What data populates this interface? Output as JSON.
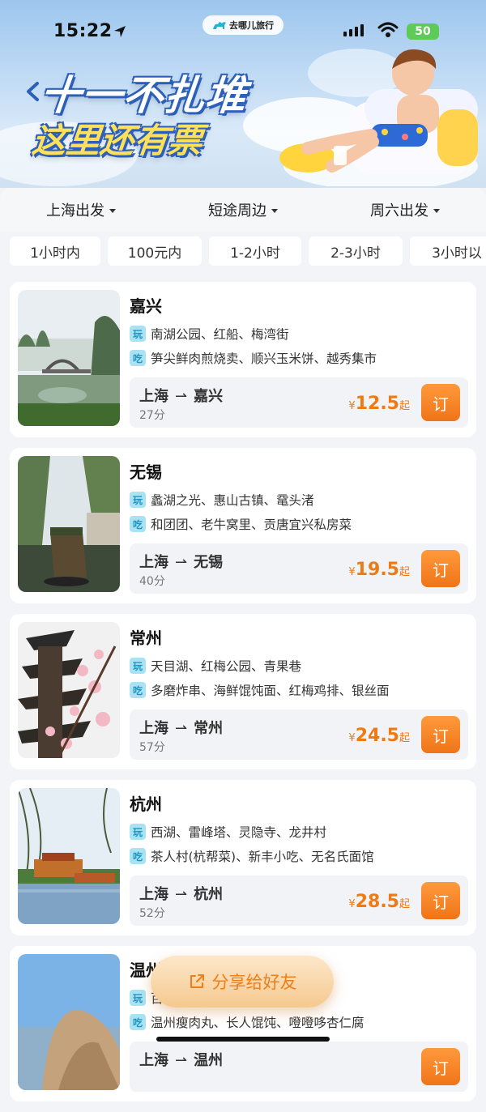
{
  "status_bar": {
    "time": "15:22",
    "battery": "50"
  },
  "app": {
    "logo_text": "去哪儿旅行"
  },
  "hero": {
    "title": "十一不扎堆",
    "subtitle": "这里还有票"
  },
  "filters": [
    {
      "label": "上海出发"
    },
    {
      "label": "短途周边"
    },
    {
      "label": "周六出发"
    }
  ],
  "chips": [
    {
      "label": "1小时内"
    },
    {
      "label": "100元内"
    },
    {
      "label": "1-2小时"
    },
    {
      "label": "2-3小时"
    },
    {
      "label": "3小时以"
    }
  ],
  "tags": {
    "play": "玩",
    "eat": "吃"
  },
  "currency": "¥",
  "price_suffix": "起",
  "route_arrow": "⇀",
  "book_label": "订",
  "cards": [
    {
      "city": "嘉兴",
      "play": "南湖公园、红船、梅湾街",
      "eat": "笋尖鲜肉煎烧卖、顺兴玉米饼、越秀集市",
      "from": "上海",
      "to": "嘉兴",
      "duration": "27分",
      "price": "12.5"
    },
    {
      "city": "无锡",
      "play": "蠡湖之光、惠山古镇、鼋头渚",
      "eat": "和团团、老牛窝里、贡唐宜兴私房菜",
      "from": "上海",
      "to": "无锡",
      "duration": "40分",
      "price": "19.5"
    },
    {
      "city": "常州",
      "play": "天目湖、红梅公园、青果巷",
      "eat": "多磨炸串、海鲜馄饨面、红梅鸡排、银丝面",
      "from": "上海",
      "to": "常州",
      "duration": "57分",
      "price": "24.5"
    },
    {
      "city": "杭州",
      "play": "西湖、雷峰塔、灵隐寺、龙井村",
      "eat": "茶人村(杭帮菜)、新丰小吃、无名氏面馆",
      "from": "上海",
      "to": "杭州",
      "duration": "52分",
      "price": "28.5"
    },
    {
      "city": "温州",
      "play": "百",
      "eat": "温州瘦肉丸、长人馄饨、噔噔哆杏仁腐",
      "from": "上海",
      "to": "温州",
      "duration": "",
      "price": ""
    }
  ],
  "share": {
    "label": "分享给好友"
  },
  "colors": {
    "accent": "#f07a12",
    "tag_bg": "#a9e3f3",
    "hero_title_stroke": "#2c5fb7"
  }
}
